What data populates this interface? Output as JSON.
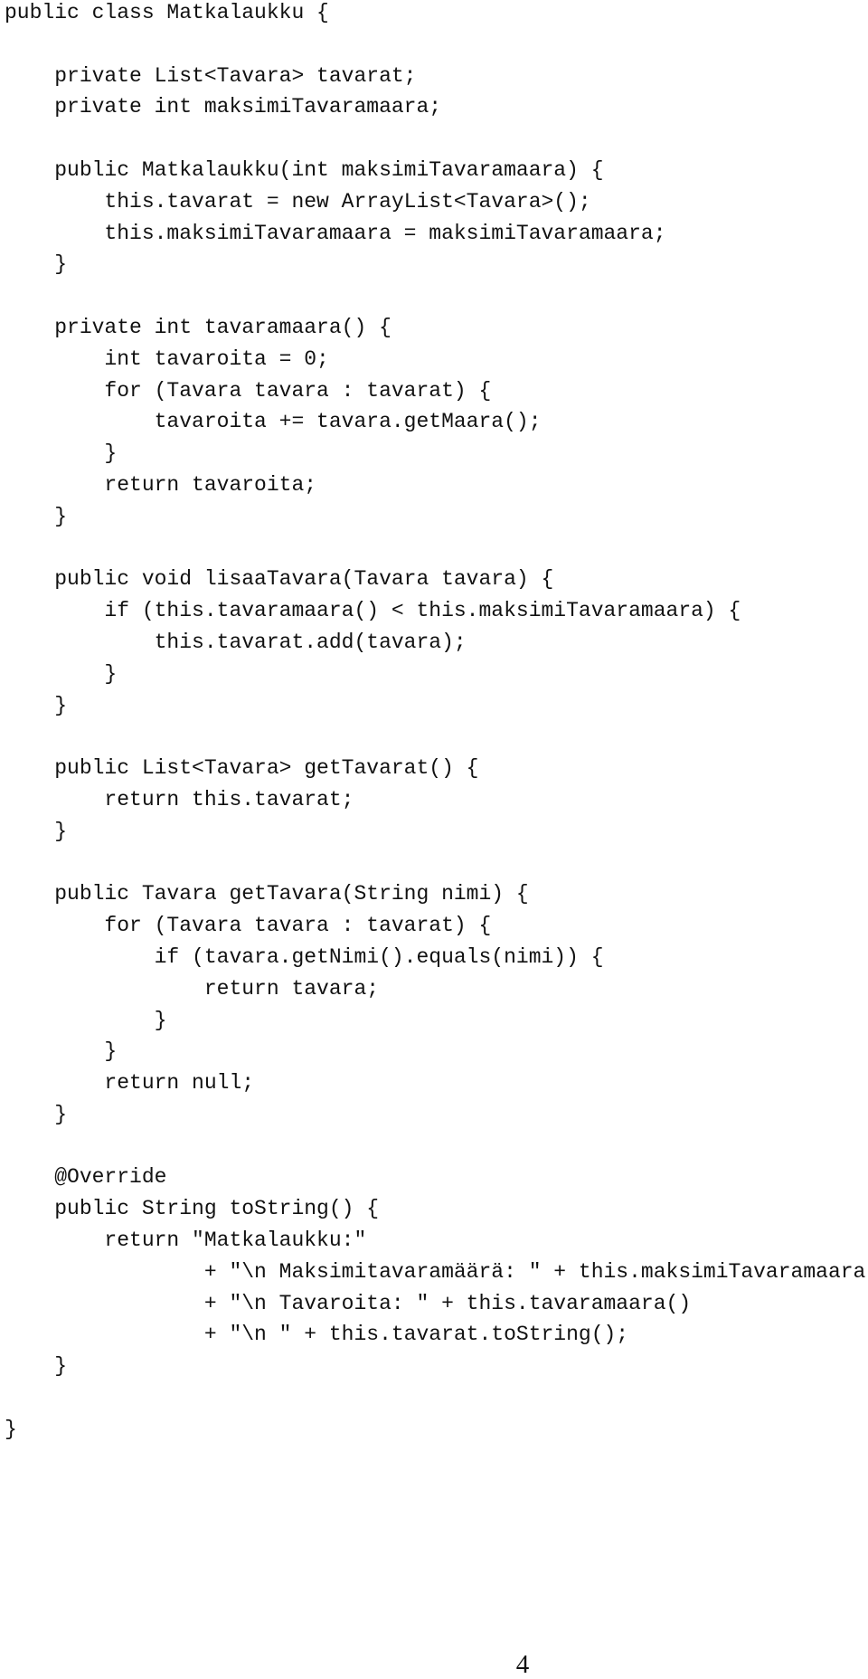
{
  "document": {
    "language": "java",
    "class_name": "Matkalaukku",
    "lines": [
      "public class Matkalaukku {",
      "",
      "    private List<Tavara> tavarat;",
      "    private int maksimiTavaramaara;",
      "",
      "    public Matkalaukku(int maksimiTavaramaara) {",
      "        this.tavarat = new ArrayList<Tavara>();",
      "        this.maksimiTavaramaara = maksimiTavaramaara;",
      "    }",
      "",
      "    private int tavaramaara() {",
      "        int tavaroita = 0;",
      "        for (Tavara tavara : tavarat) {",
      "            tavaroita += tavara.getMaara();",
      "        }",
      "        return tavaroita;",
      "    }",
      "",
      "    public void lisaaTavara(Tavara tavara) {",
      "        if (this.tavaramaara() < this.maksimiTavaramaara) {",
      "            this.tavarat.add(tavara);",
      "        }",
      "    }",
      "",
      "    public List<Tavara> getTavarat() {",
      "        return this.tavarat;",
      "    }",
      "",
      "    public Tavara getTavara(String nimi) {",
      "        for (Tavara tavara : tavarat) {",
      "            if (tavara.getNimi().equals(nimi)) {",
      "                return tavara;",
      "            }",
      "        }",
      "        return null;",
      "    }",
      "",
      "    @Override",
      "    public String toString() {",
      "        return \"Matkalaukku:\"",
      "                + \"\\n Maksimitavaramäärä: \" + this.maksimiTavaramaara",
      "                + \"\\n Tavaroita: \" + this.tavaramaara()",
      "                + \"\\n \" + this.tavarat.toString();",
      "    }",
      "",
      "}"
    ],
    "page_number": "4"
  }
}
